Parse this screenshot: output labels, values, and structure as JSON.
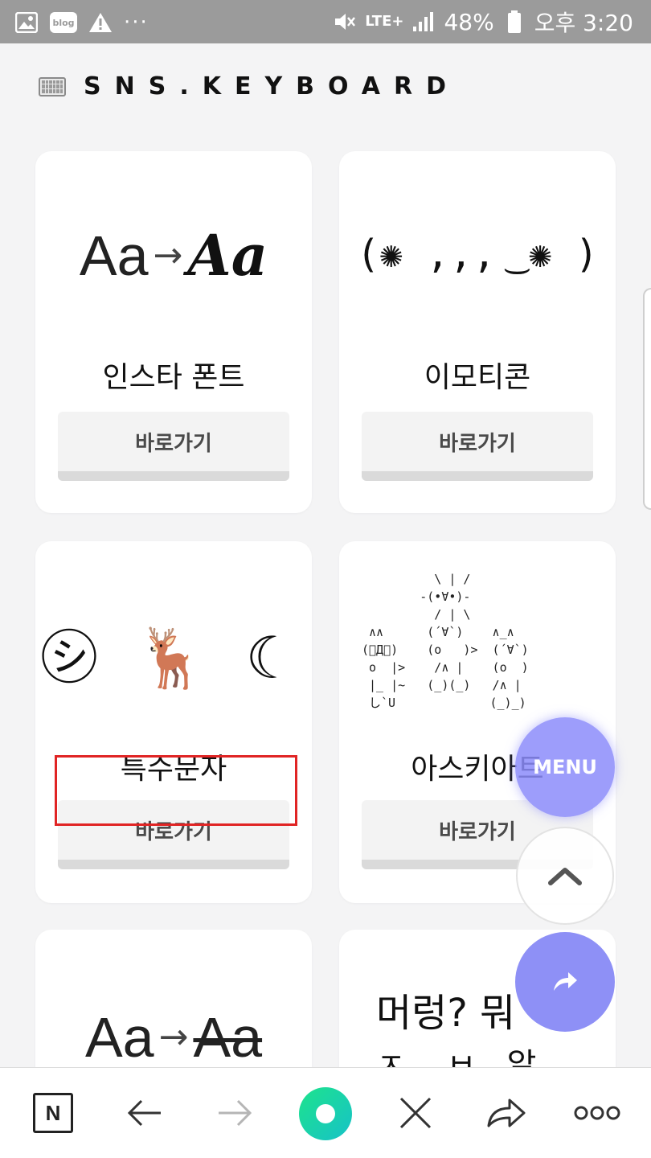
{
  "status_bar": {
    "battery": "48%",
    "time": "오후 3:20",
    "network": "LTE+",
    "dots": "···"
  },
  "header": {
    "title": "SNS.KEYBOARD"
  },
  "cards": [
    {
      "title": "인스타 폰트",
      "button": "바로가기",
      "demo_from": "Aa",
      "demo_arrow": "→",
      "demo_to": "Aa"
    },
    {
      "title": "이모티콘",
      "button": "바로가기",
      "art": "(✺ ,,, ͜ ✺ )"
    },
    {
      "title": "특수문자",
      "button": "바로가기",
      "art": "㋛ 🦌 ☾"
    },
    {
      "title": "아스키아트",
      "button": "바로가기"
    },
    {
      "demo_from": "Aa",
      "demo_arrow": "→",
      "demo_to": "Aa"
    },
    {
      "art_line1": "머렁? 뭐",
      "art_line2": "ㅈ... ㅂ...알..."
    }
  ],
  "fab": {
    "menu_label": "MENU"
  },
  "toolbar": {
    "naver_label": "N"
  },
  "colors": {
    "status_bar": "#9b9b9b",
    "fab_menu": "#8c8cfa",
    "fab_share": "#8e90f6",
    "highlight": "#e02424",
    "green_start": "#1de38c",
    "green_end": "#17c2c8"
  }
}
